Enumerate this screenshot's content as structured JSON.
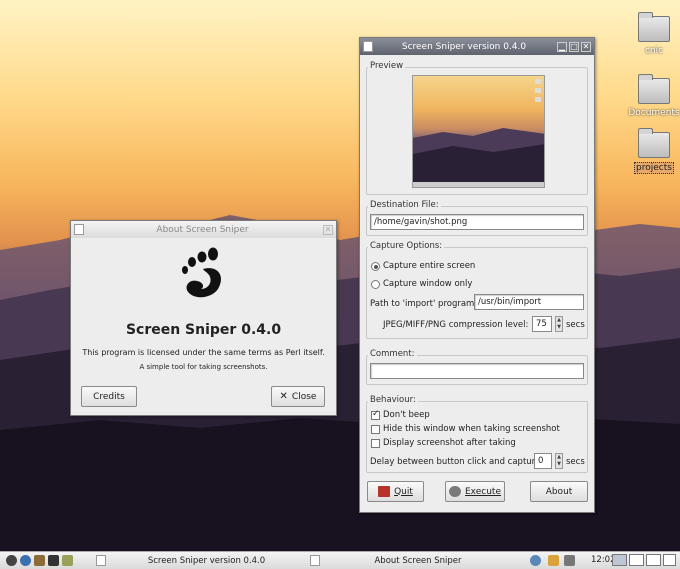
{
  "desktop": {
    "icons": [
      {
        "label": "cnic",
        "selected": false
      },
      {
        "label": "Documents",
        "selected": false
      },
      {
        "label": "projects",
        "selected": true
      }
    ]
  },
  "about_dialog": {
    "title": "About Screen Sniper",
    "app_name": "Screen Sniper 0.4.0",
    "license": "This program is licensed under the same terms as Perl itself.",
    "description": "A simple tool for taking screenshots.",
    "credits_label": "Credits",
    "close_label": "Close",
    "close_glyph": "✕"
  },
  "main_window": {
    "title": "Screen Sniper version 0.4.0",
    "preview_label": "Preview",
    "destination_label": "Destination File:",
    "destination_value": "/home/gavin/shot.png",
    "capture_options_label": "Capture Options:",
    "capture_entire_label": "Capture entire screen",
    "capture_entire_selected": true,
    "capture_window_label": "Capture window only",
    "capture_window_selected": false,
    "import_path_label": "Path to 'import' program:",
    "import_path_value": "/usr/bin/import",
    "compression_label": "JPEG/MIFF/PNG compression level:",
    "compression_value": "75",
    "compression_unit": "secs",
    "comment_label": "Comment:",
    "comment_value": "",
    "behaviour_label": "Behaviour:",
    "dont_beep_label": "Don't beep",
    "dont_beep_checked": true,
    "hide_window_label": "Hide this window when taking screenshot",
    "hide_window_checked": false,
    "display_after_label": "Display screenshot after taking",
    "display_after_checked": false,
    "delay_label": "Delay between button click and capture:",
    "delay_value": "0",
    "delay_unit": "secs",
    "quit_label": "Quit",
    "execute_label": "Execute",
    "about_label": "About"
  },
  "taskbar": {
    "tasks": [
      "Screen Sniper version 0.4.0",
      "About Screen Sniper"
    ],
    "clock": "12:02"
  },
  "colors": {
    "titlebar_active": "#6e737d",
    "desktop_sky": "#f8b65d",
    "selected_label": "#e6a86b"
  }
}
